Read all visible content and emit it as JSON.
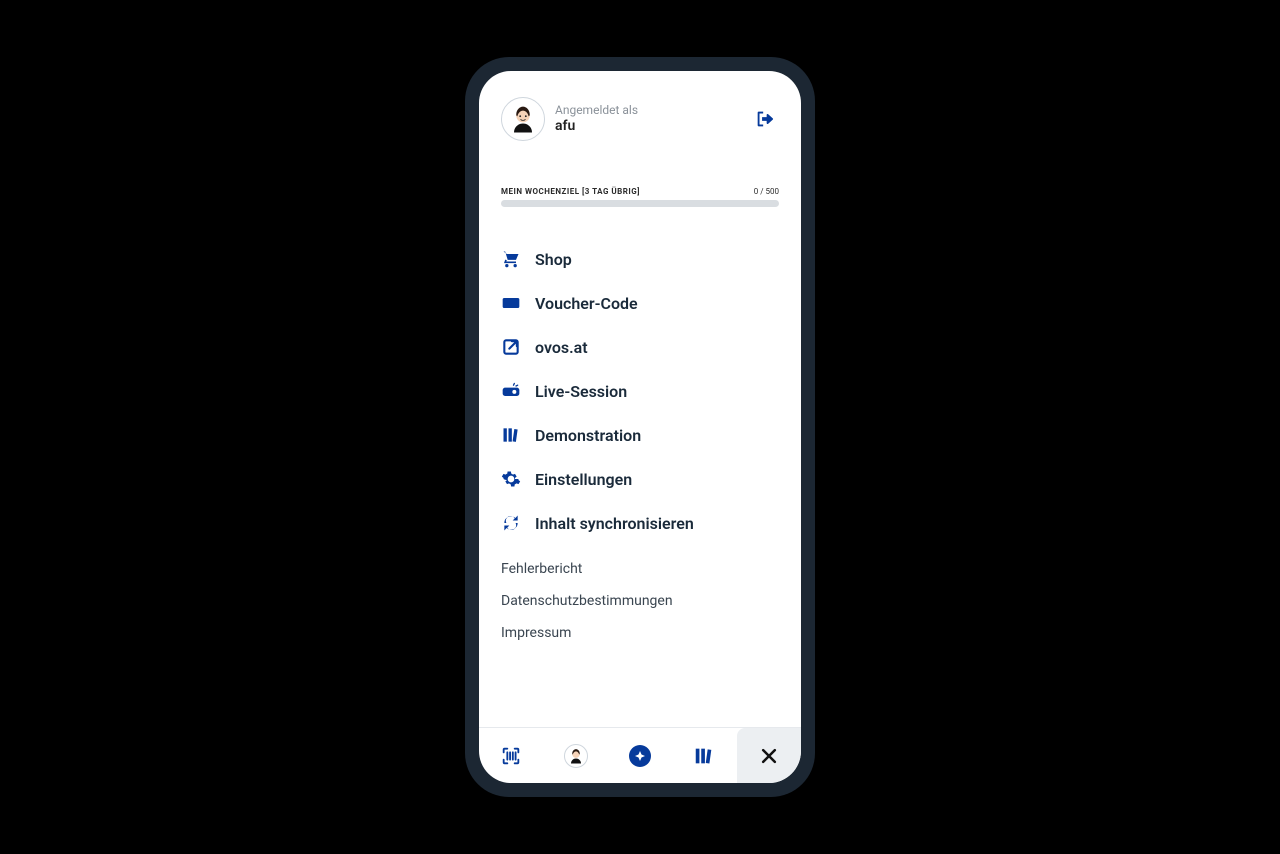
{
  "header": {
    "logged_in_as_caption": "Angemeldet als",
    "username": "afu"
  },
  "progress": {
    "label": "MEIN WOCHENZIEL [3 TAG ÜBRIG]",
    "value_text": "0 / 500"
  },
  "menu": {
    "items": [
      {
        "key": "shop",
        "label": "Shop",
        "icon": "cart-icon"
      },
      {
        "key": "voucher",
        "label": "Voucher-Code",
        "icon": "ticket-icon"
      },
      {
        "key": "ovos",
        "label": "ovos.at",
        "icon": "external-link-icon"
      },
      {
        "key": "live",
        "label": "Live-Session",
        "icon": "projector-icon"
      },
      {
        "key": "demo",
        "label": "Demonstration",
        "icon": "books-icon"
      },
      {
        "key": "settings",
        "label": "Einstellungen",
        "icon": "gear-icon"
      },
      {
        "key": "sync",
        "label": "Inhalt synchronisieren",
        "icon": "sync-icon"
      }
    ]
  },
  "secondary_links": [
    {
      "key": "bug",
      "label": "Fehlerbericht"
    },
    {
      "key": "privacy",
      "label": "Datenschutzbestimmungen"
    },
    {
      "key": "imprint",
      "label": "Impressum"
    }
  ],
  "colors": {
    "accent": "#063a9b"
  }
}
